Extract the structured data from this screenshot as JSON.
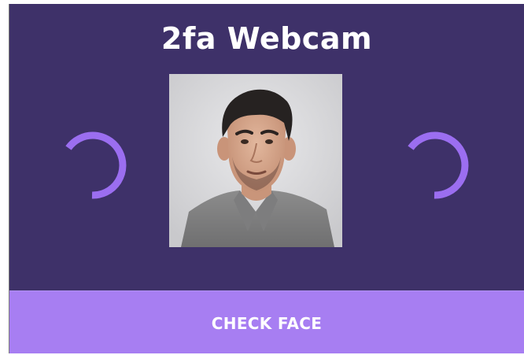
{
  "app": {
    "title": "2fa Webcam"
  },
  "camera": {
    "status_indicator_left": "loading-spinner",
    "status_indicator_right": "loading-spinner",
    "preview_subject": "face-photo"
  },
  "actions": {
    "check_face_label": "CHECK FACE"
  },
  "colors": {
    "panel_background": "#3e3169",
    "button_background": "#a77ef2",
    "spinner_accent": "#9b6ef0",
    "title_text": "#ffffff"
  }
}
